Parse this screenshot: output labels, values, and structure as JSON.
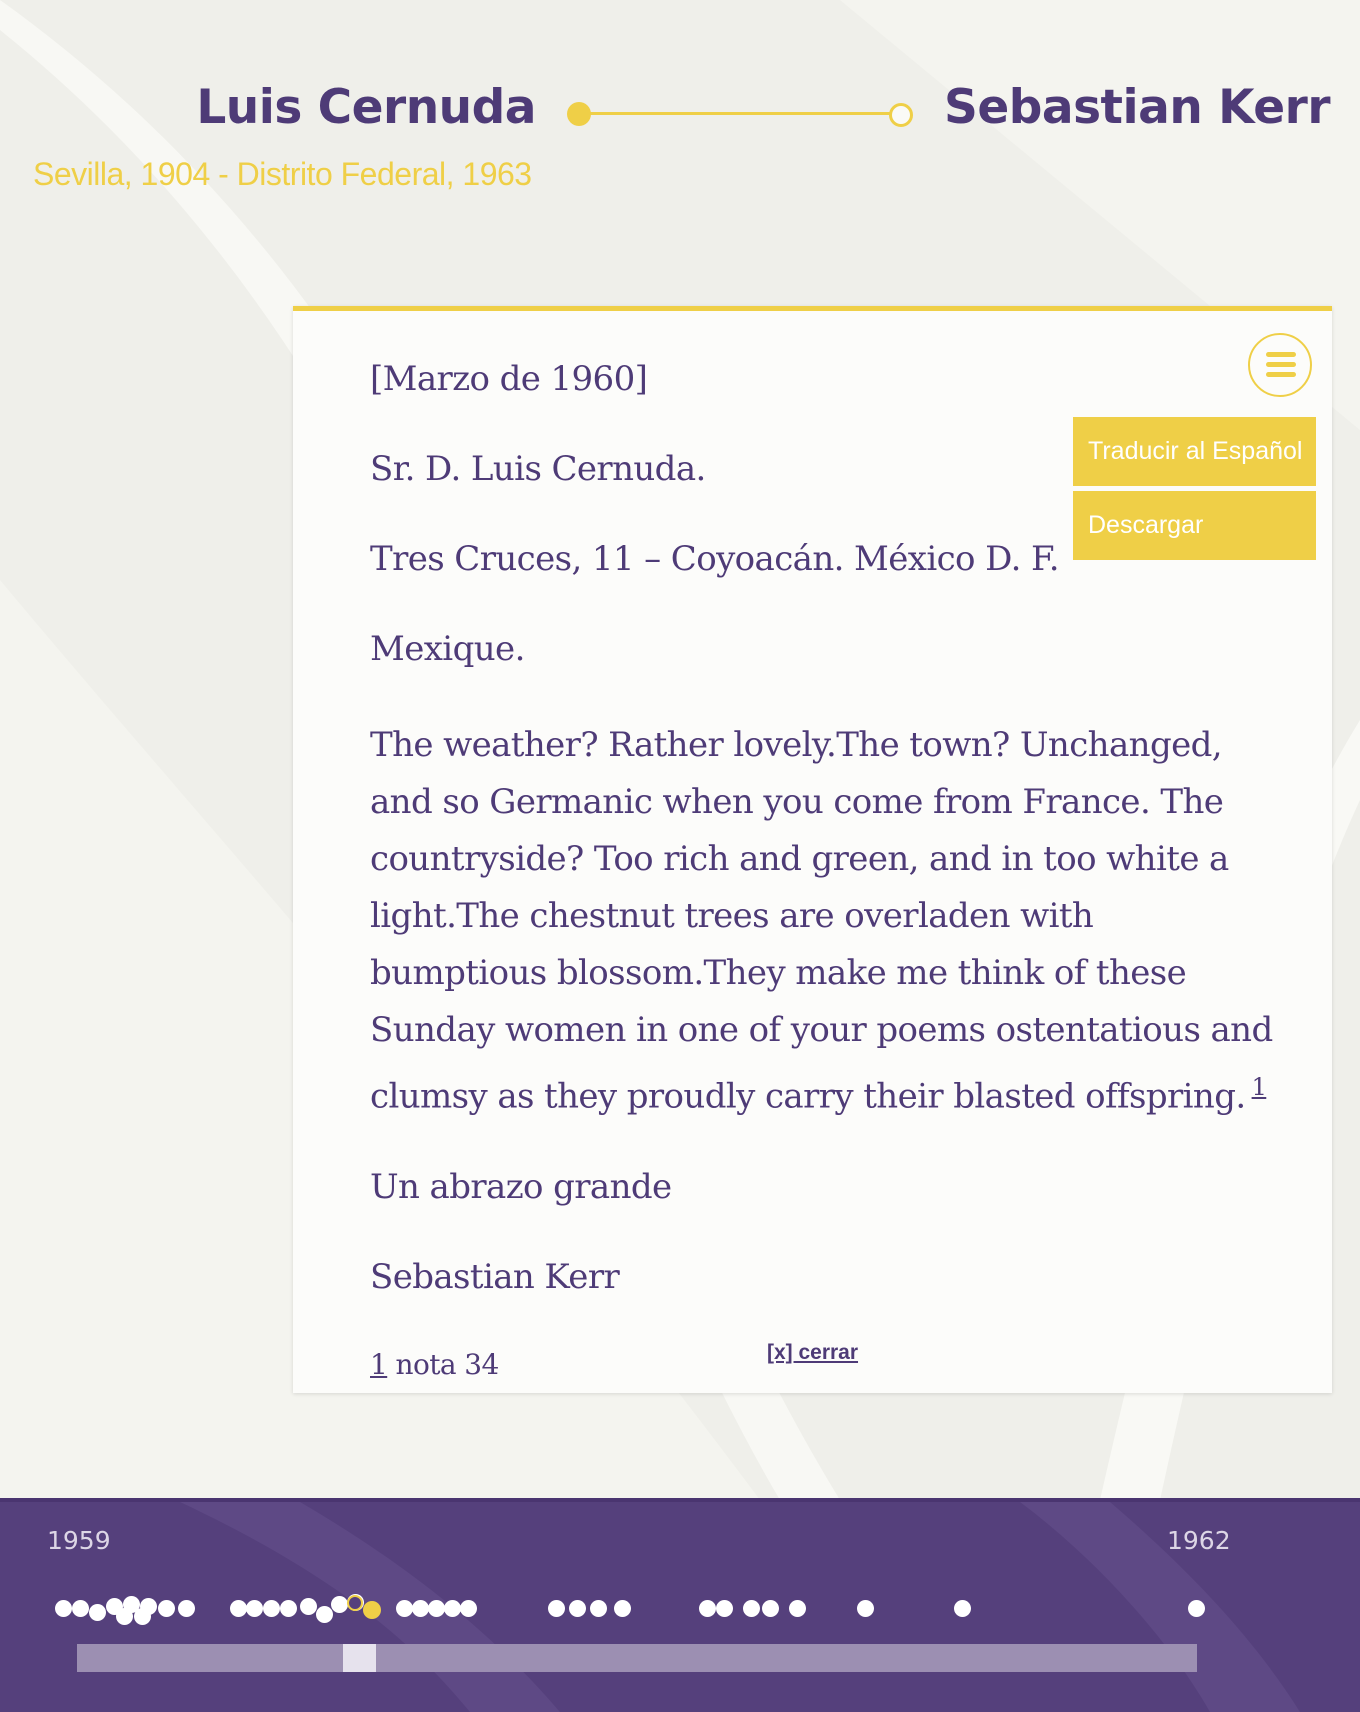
{
  "header": {
    "author_name": "Luis Cernuda",
    "author_dates": "Sevilla, 1904 - Distrito Federal, 1963",
    "correspondent_name": "Sebastian Kerr"
  },
  "letter": {
    "date": "[Marzo de 1960]",
    "recipient": "Sr. D. Luis Cernuda.",
    "address": "Tres Cruces, 11 – Coyoacán. México D. F.",
    "country": "Mexique.",
    "body": "The weather? Rather lovely.The town? Unchanged, and so Germanic when you come from France. The countryside? Too rich and green, and in too white a light.The chestnut trees are overladen with bumptious blossom.They make me think of these Sunday women in one of your poems ostentatious and clumsy as they proudly carry their blasted offspring.",
    "footnote_ref": "1",
    "closing": "Un abrazo grande",
    "signature": "Sebastian Kerr",
    "footnote": {
      "number": "1",
      "text": "nota 34"
    },
    "close_label": "[x] cerrar"
  },
  "menu": {
    "icon": "hamburger-menu-icon",
    "items": [
      {
        "label": "Traducir al Español"
      },
      {
        "label": "Descargar"
      }
    ]
  },
  "timeline": {
    "start_year": "1959",
    "end_year": "1962",
    "slider_position": 0.25,
    "colors": {
      "background": "#55407c",
      "dot": "#ffffff",
      "active": "#efcf47",
      "track": "#9c8fb2",
      "thumb": "#e6e2ed"
    }
  },
  "colors": {
    "accent": "#efcf47",
    "primary": "#4e3b77",
    "page_bg": "#f4f4ef",
    "card_bg": "#fcfcfa"
  }
}
